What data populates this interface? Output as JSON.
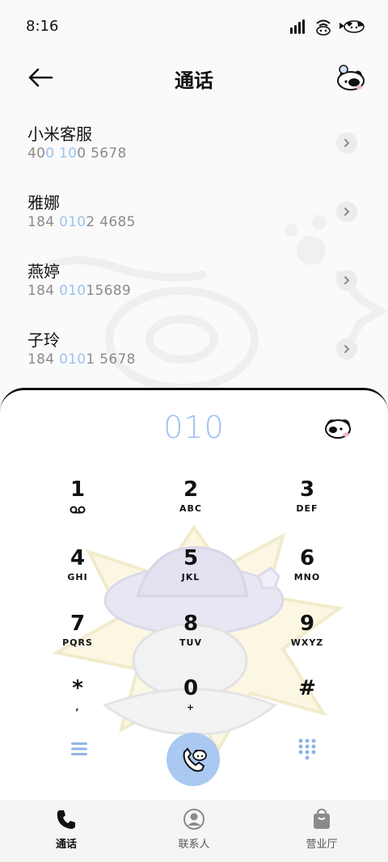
{
  "status_bar": {
    "time": "8:16"
  },
  "header": {
    "title": "通话"
  },
  "suggestions": [
    {
      "name": "小米客服",
      "num_pre": "40",
      "num_hl": "0 10",
      "num_post": "0 5678"
    },
    {
      "name": "雅娜",
      "num_pre": "184 ",
      "num_hl": "010",
      "num_post": "2 4685"
    },
    {
      "name": "燕婷",
      "num_pre": "184 ",
      "num_hl": "010",
      "num_post": "15689"
    },
    {
      "name": "子玲",
      "num_pre": "184 ",
      "num_hl": "010",
      "num_post": "1 5678"
    }
  ],
  "dialer": {
    "input": "010",
    "keys": [
      {
        "digit": "1",
        "letters": ""
      },
      {
        "digit": "2",
        "letters": "ABC"
      },
      {
        "digit": "3",
        "letters": "DEF"
      },
      {
        "digit": "4",
        "letters": "GHI"
      },
      {
        "digit": "5",
        "letters": "JKL"
      },
      {
        "digit": "6",
        "letters": "MNO"
      },
      {
        "digit": "7",
        "letters": "PQRS"
      },
      {
        "digit": "8",
        "letters": "TUV"
      },
      {
        "digit": "9",
        "letters": "WXYZ"
      },
      {
        "digit": "*",
        "letters": ","
      },
      {
        "digit": "0",
        "letters": "+"
      },
      {
        "digit": "#",
        "letters": ""
      }
    ]
  },
  "bottom_nav": [
    {
      "label": "通话",
      "icon": "phone-icon",
      "active": true
    },
    {
      "label": "联系人",
      "icon": "person-icon",
      "active": false
    },
    {
      "label": "营业厅",
      "icon": "shopping-bag-icon",
      "active": false
    }
  ],
  "colors": {
    "accent": "#9cc2ee",
    "call_button": "#a9c9f2",
    "text": "#111111",
    "muted": "#8a8a8a"
  }
}
